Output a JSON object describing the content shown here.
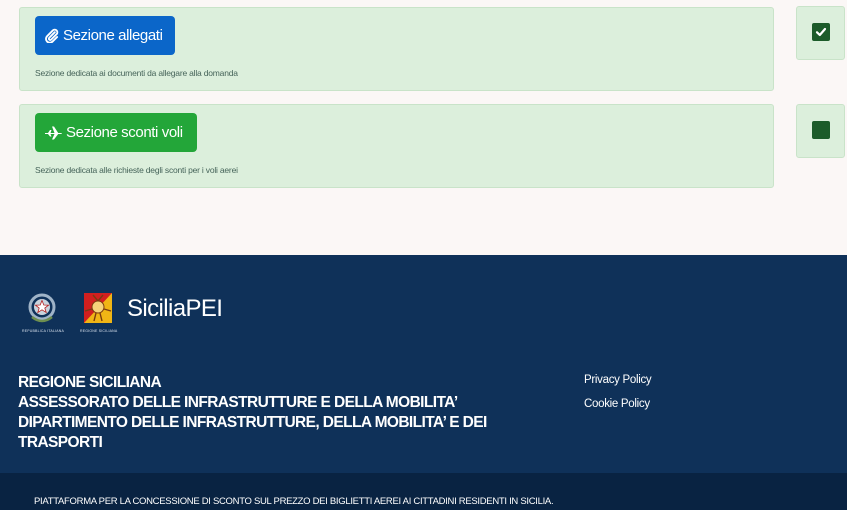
{
  "sections": [
    {
      "button_label": "Sezione allegati",
      "icon": "paperclip-icon",
      "description": "Sezione dedicata ai documenti da allegare alla domanda",
      "button_color": "#0b66c9",
      "checked": true
    },
    {
      "button_label": "Sezione sconti voli",
      "icon": "plane-icon",
      "description": "Sezione dedicata alle richieste degli sconti per i voli aerei",
      "button_color": "#23a639",
      "checked": false
    }
  ],
  "footer": {
    "brand_name": "SiciliaPEI",
    "emblem_republic_caption": "REPUBBLICA ITALIANA",
    "emblem_sicily_caption": "REGIONE SICILIANA",
    "region_lines": [
      "REGIONE SICILIANA",
      "ASSESSORATO DELLE INFRASTRUTTURE E DELLA MOBILITA’",
      "DIPARTIMENTO DELLE INFRASTRUTTURE, DELLA MOBILITA’ E DEI",
      "TRASPORTI"
    ],
    "links": [
      "Privacy Policy",
      "Cookie Policy"
    ],
    "bottom_text": "PIATTAFORMA PER LA CONCESSIONE DI SCONTO SUL PREZZO DEI BIGLIETTI AEREI AI CITTADINI RESIDENTI IN SICILIA.",
    "background_color": "#0f3159",
    "bottom_bar_color": "#092342"
  }
}
